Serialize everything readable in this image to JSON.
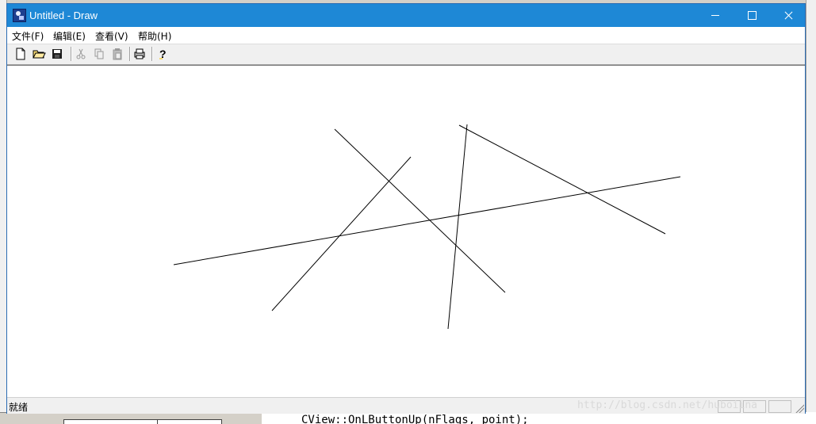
{
  "window": {
    "title": "Untitled - Draw",
    "title_color": "#1e88d6"
  },
  "menu": {
    "items": [
      {
        "label": "文件(F)"
      },
      {
        "label": "编辑(E)"
      },
      {
        "label": "查看(V)"
      },
      {
        "label": "帮助(H)"
      }
    ]
  },
  "toolbar": {
    "buttons": [
      {
        "icon": "new-file-icon"
      },
      {
        "icon": "open-folder-icon"
      },
      {
        "icon": "save-icon"
      },
      {
        "icon": "cut-icon"
      },
      {
        "icon": "copy-icon"
      },
      {
        "icon": "paste-icon"
      },
      {
        "icon": "print-icon"
      },
      {
        "icon": "help-icon"
      }
    ]
  },
  "status": {
    "text": "就绪"
  },
  "background": {
    "code_text": "CView::OnLButtonUp(nFlags, point);"
  },
  "watermark": {
    "text": "http://blog.csdn.net/huboiina"
  },
  "colors": {
    "line": "#000000"
  }
}
